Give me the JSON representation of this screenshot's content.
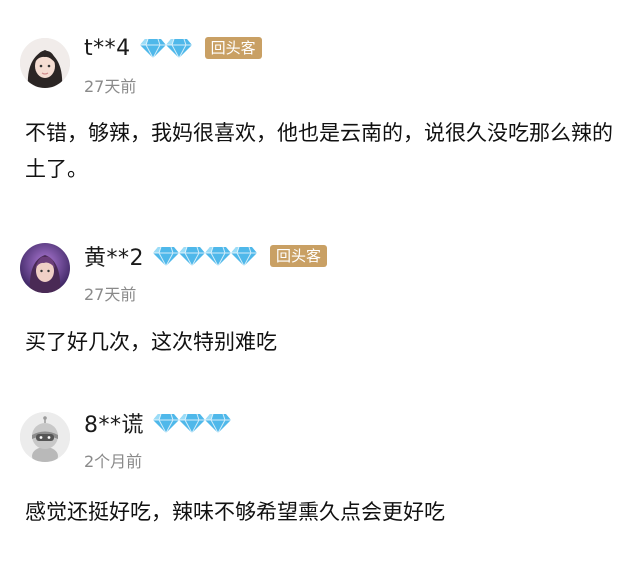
{
  "reviews": [
    {
      "username": "t**4",
      "diamond_count": 2,
      "badge": "回头客",
      "time": "27天前",
      "content": "不错，够辣，我妈很喜欢，他也是云南的，说很久没吃那么辣的土了。"
    },
    {
      "username": "黄**2",
      "diamond_count": 4,
      "badge": "回头客",
      "time": "27天前",
      "content": "买了好几次，这次特别难吃"
    },
    {
      "username": "8**谎",
      "diamond_count": 3,
      "badge": "",
      "time": "2个月前",
      "content": "感觉还挺好吃，辣味不够希望熏久点会更好吃"
    }
  ],
  "colors": {
    "diamond": "#4fb8ea",
    "badge_bg": "#c9a064",
    "time_text": "#8a8a8a"
  },
  "icons": {
    "member_level": "diamond-icon"
  }
}
